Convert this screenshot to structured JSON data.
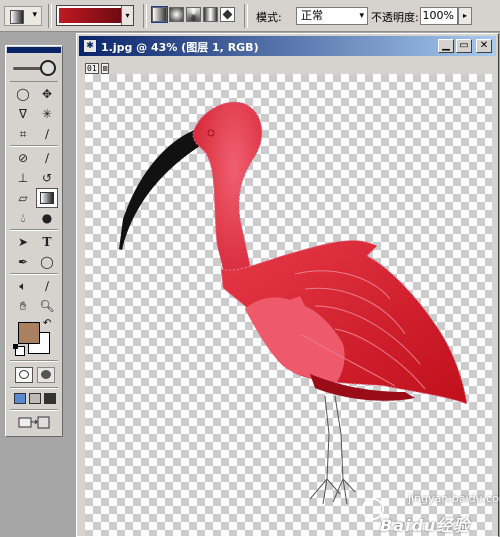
{
  "options_bar": {
    "mode_label": "模式:",
    "mode_value": "正常",
    "opacity_label": "不透明度:",
    "opacity_value": "100%",
    "gradient_colors": [
      "#c01a24",
      "#6e0a10"
    ],
    "gradient_types": [
      "linear-gradient",
      "radial-gradient",
      "angle-gradient",
      "reflected-gradient",
      "diamond-gradient"
    ],
    "selected_gradient_type": "linear-gradient"
  },
  "toolbox": {
    "foreground_color": "#a98060",
    "background_color": "#ffffff",
    "active_tool": "gradient-tool",
    "tools": [
      "marquee-tool",
      "move-tool",
      "lasso-tool",
      "magic-wand-tool",
      "crop-tool",
      "slice-tool",
      "healing-brush-tool",
      "brush-tool",
      "clone-stamp-tool",
      "history-brush-tool",
      "eraser-tool",
      "gradient-tool",
      "blur-tool",
      "dodge-tool",
      "path-selection-tool",
      "type-tool",
      "pen-tool",
      "shape-tool",
      "notes-tool",
      "eyedropper-tool",
      "hand-tool",
      "zoom-tool"
    ]
  },
  "document": {
    "title": "1.jpg @ 43% (图层 1, RGB)",
    "corner_labels": [
      "01",
      "⊠"
    ],
    "window_buttons": [
      "minimize",
      "maximize",
      "close"
    ]
  },
  "watermark": {
    "text": "Baidu经验",
    "subtext": "jingyan.baidu.com"
  }
}
